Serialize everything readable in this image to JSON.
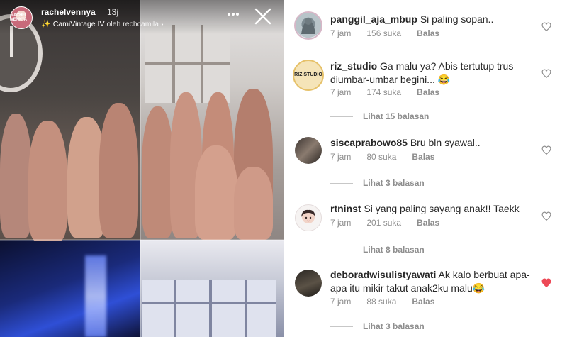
{
  "story": {
    "username": "rachelvennya",
    "time_ago": "13j",
    "avatar_text": "RACHEL VENNYA",
    "music": {
      "track": "CamiVintage IV",
      "by_label": "oleh rechcamila",
      "chevron": "›"
    },
    "more_icon": "more-horizontal-icon",
    "close_icon": "close-icon"
  },
  "comments": [
    {
      "username": "panggil_aja_mbup",
      "text": "Si paling sopan..",
      "time": "7 jam",
      "likes": "156 suka",
      "reply_label": "Balas",
      "liked": false,
      "view_replies": ""
    },
    {
      "username": "riz_studio",
      "text": "Ga malu ya? Abis tertutup trus diumbar-umbar begini... 😂",
      "time": "7 jam",
      "likes": "174 suka",
      "reply_label": "Balas",
      "liked": false,
      "view_replies": "Lihat 15 balasan",
      "avatar_text": "RIZ STUDIO"
    },
    {
      "username": "siscaprabowo85",
      "text": "Bru bln syawal..",
      "time": "7 jam",
      "likes": "80 suka",
      "reply_label": "Balas",
      "liked": false,
      "view_replies": "Lihat 3 balasan"
    },
    {
      "username": "rtninst",
      "text": "Si yang paling sayang anak!! Taekk",
      "time": "7 jam",
      "likes": "201 suka",
      "reply_label": "Balas",
      "liked": false,
      "view_replies": "Lihat 8 balasan"
    },
    {
      "username": "deboradwisulistyawati",
      "text": "Ak kalo berbuat apa-apa itu mikir takut anak2ku malu😂",
      "time": "7 jam",
      "likes": "88 suka",
      "reply_label": "Balas",
      "liked": true,
      "view_replies": "Lihat 3 balasan"
    }
  ],
  "colors": {
    "heart_liked": "#ed4956",
    "heart_outline": "#8e8e8e",
    "meta_text": "#8e8e8e",
    "body_text": "#262626"
  }
}
